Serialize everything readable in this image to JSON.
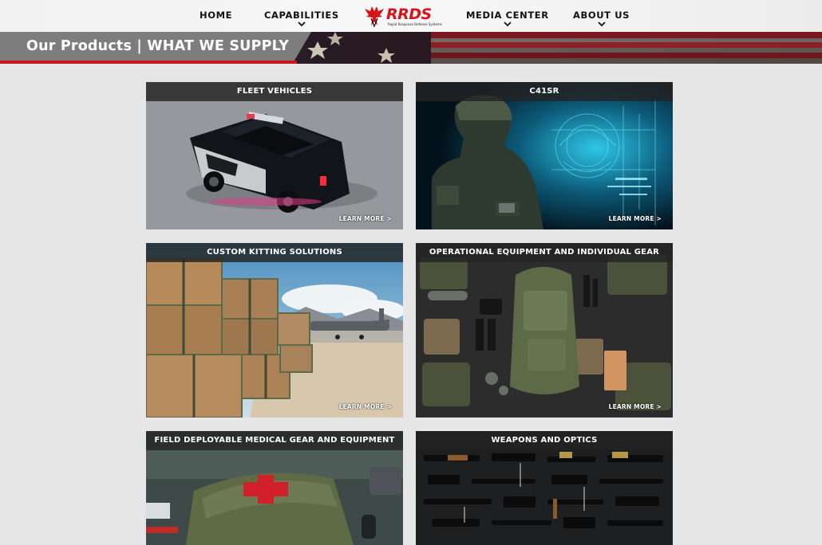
{
  "nav": {
    "home": "HOME",
    "capabilities": "CAPABILITIES",
    "media_center": "MEDIA CENTER",
    "about_us": "ABOUT US"
  },
  "logo": {
    "name": "RRDS",
    "tagline": "Rapid Response Defense Systems"
  },
  "banner": {
    "title": "Our Products | WHAT WE SUPPLY"
  },
  "products": [
    {
      "title": "FLEET VEHICLES",
      "link": "LEARN MORE >",
      "image": "police-suv-image"
    },
    {
      "title": "C41SR",
      "link": "LEARN MORE >",
      "image": "soldier-digital-interface-image"
    },
    {
      "title": "CUSTOM KITTING SOLUTIONS",
      "link": "LEARN MORE >",
      "image": "cargo-pallets-aircraft-image"
    },
    {
      "title": "OPERATIONAL EQUIPMENT AND INDIVIDUAL GEAR",
      "link": "LEARN MORE >",
      "image": "tactical-gear-flatlay-image"
    },
    {
      "title": "FIELD DEPLOYABLE MEDICAL GEAR AND EQUIPMENT",
      "image": "medical-kit-image"
    },
    {
      "title": "WEAPONS AND OPTICS",
      "image": "weapons-flatlay-image"
    }
  ],
  "colors": {
    "accent_red": "#c8161d",
    "banner_gray": "#7d7d7d",
    "page_bg": "#e6e6e6",
    "card_header": "#232323"
  }
}
